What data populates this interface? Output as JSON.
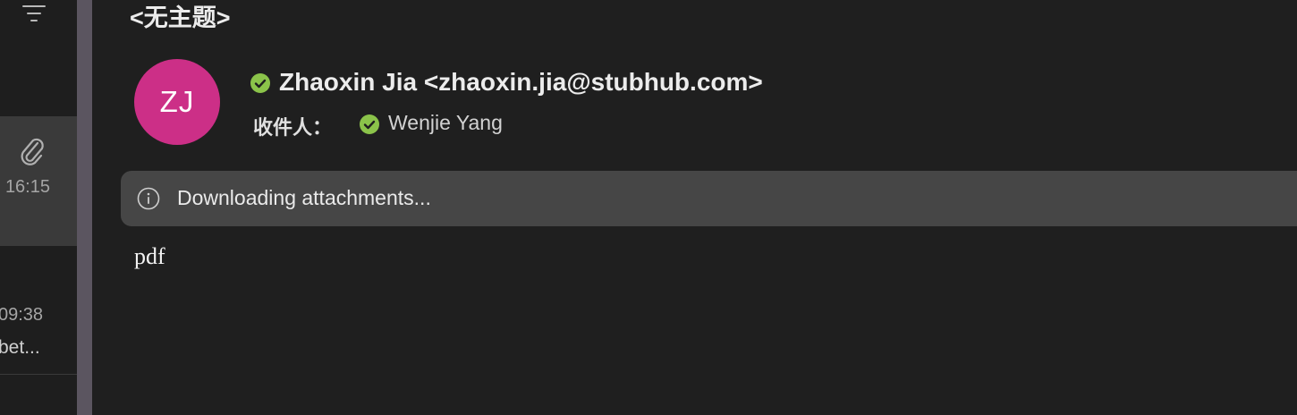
{
  "message_list": {
    "selected_item": {
      "time": "16:15",
      "has_attachment": true,
      "attachment_icon": "paperclip-icon"
    },
    "second_item": {
      "time": "09:38",
      "snippet": "bet..."
    },
    "filter_icon": "filter-icon"
  },
  "message": {
    "subject": "<无主题>",
    "avatar_initials": "ZJ",
    "sender": "Zhaoxin Jia <zhaoxin.jia@stubhub.com>",
    "to_label": "收件人：",
    "recipient": "Wenjie Yang",
    "info_bar_text": "Downloading attachments...",
    "body": "pdf"
  },
  "colors": {
    "background": "#1f1f1f",
    "avatar": "#cc2f87",
    "verified_check": "#8bc34a",
    "info_bar": "#464646",
    "split_bar": "#5b5560",
    "selected_item": "#3a3a3a"
  }
}
